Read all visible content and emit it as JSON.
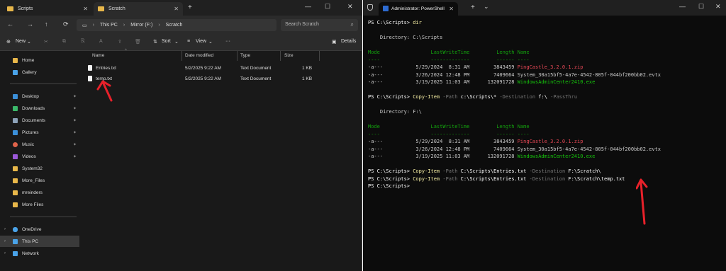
{
  "explorer": {
    "tabs": [
      {
        "label": "Scripts",
        "close": "✕"
      },
      {
        "label": "Scratch",
        "close": "✕"
      }
    ],
    "new_tab": "+",
    "window_controls": [
      "—",
      "☐",
      "✕"
    ],
    "nav_icons": [
      "←",
      "→",
      "↑",
      "⟳"
    ],
    "breadcrumb": {
      "monitor": "▭",
      "items": [
        "This PC",
        "Mirror (F:)",
        "Scratch"
      ],
      "sep": "›"
    },
    "search_placeholder": "Search Scratch",
    "search_icon": "⌕",
    "toolbar": {
      "new_label": "New",
      "new_plus": "⊕",
      "caret": "⌄",
      "dim_icons": [
        "✂",
        "⧉",
        "⎘",
        "A",
        "⇪",
        "🗑"
      ],
      "sort_label": "Sort",
      "view_label": "View",
      "more": "···",
      "details_label": "Details"
    },
    "nav_items": [
      {
        "label": "Home",
        "color": "#e8b74a"
      },
      {
        "label": "Gallery",
        "color": "#4aa3e8"
      },
      {
        "label": "Desktop",
        "color": "#3b8fd9"
      },
      {
        "label": "Downloads",
        "color": "#3bb86a"
      },
      {
        "label": "Documents",
        "color": "#8da2b8"
      },
      {
        "label": "Pictures",
        "color": "#3b8fd9"
      },
      {
        "label": "Music",
        "color": "#e0634a"
      },
      {
        "label": "Videos",
        "color": "#9b59d9"
      },
      {
        "label": "System32",
        "color": "#e8b74a"
      },
      {
        "label": "More_Files",
        "color": "#e8b74a"
      },
      {
        "label": "mreinders",
        "color": "#e8b74a"
      },
      {
        "label": "More Files",
        "color": "#e8b74a"
      },
      {
        "label": "OneDrive",
        "color": "#4aa3e8"
      },
      {
        "label": "This PC",
        "color": "#4aa3e8"
      },
      {
        "label": "Network",
        "color": "#4aa3e8"
      }
    ],
    "pin_glyph": "📌",
    "chevron": "›",
    "columns": [
      "Name",
      "Date modified",
      "Type",
      "Size"
    ],
    "sort_arrow": "^",
    "files": [
      {
        "name": "Entries.txt",
        "date": "5/2/2025 9:22 AM",
        "type": "Text Document",
        "size": "1 KB"
      },
      {
        "name": "temp.txt",
        "date": "5/2/2025 9:22 AM",
        "type": "Text Document",
        "size": "1 KB"
      }
    ]
  },
  "terminal": {
    "tab_title": "Administrator: PowerShell",
    "tab_close": "✕",
    "new_tab": "+",
    "dropdown": "⌄",
    "window_controls": [
      "—",
      "☐",
      "✕"
    ],
    "lines": [
      {
        "spans": [
          {
            "t": "PS C:\\Scripts> ",
            "c": "w"
          },
          {
            "t": "dir",
            "c": "y"
          }
        ]
      },
      {
        "spans": [
          {
            "t": "",
            "c": ""
          }
        ]
      },
      {
        "spans": [
          {
            "t": "    Directory: C:\\Scripts",
            "c": ""
          }
        ]
      },
      {
        "spans": [
          {
            "t": "",
            "c": ""
          }
        ]
      },
      {
        "spans": [
          {
            "t": "Mode                 LastWriteTime         Length Name",
            "c": "g"
          }
        ]
      },
      {
        "spans": [
          {
            "t": "----                 -------------         ------ ----",
            "c": "g"
          }
        ]
      },
      {
        "spans": [
          {
            "t": "-a---           5/29/2024  8:31 AM        3843459 ",
            "c": ""
          },
          {
            "t": "PingCastle_3.2.0.1.zip",
            "c": "r"
          }
        ]
      },
      {
        "spans": [
          {
            "t": "-a---           3/26/2024 12:48 PM        7409664 System_30a15bf5-4a7e-4542-805f-044bf200bb02.evtx",
            "c": ""
          }
        ]
      },
      {
        "spans": [
          {
            "t": "-a---           3/19/2025 11:03 AM      132091728 ",
            "c": ""
          },
          {
            "t": "WindowsAdminCenter2410.exe",
            "c": "hl-g"
          }
        ]
      },
      {
        "spans": [
          {
            "t": "",
            "c": ""
          }
        ]
      },
      {
        "spans": [
          {
            "t": "PS C:\\Scripts> ",
            "c": "w"
          },
          {
            "t": "Copy-Item",
            "c": "y"
          },
          {
            "t": " -Path ",
            "c": "k"
          },
          {
            "t": "c:\\Scripts\\*",
            "c": "w"
          },
          {
            "t": " -Destination ",
            "c": "k"
          },
          {
            "t": "f:\\",
            "c": "w"
          },
          {
            "t": " -PassThru",
            "c": "k"
          }
        ]
      },
      {
        "spans": [
          {
            "t": "",
            "c": ""
          }
        ]
      },
      {
        "spans": [
          {
            "t": "    Directory: F:\\",
            "c": ""
          }
        ]
      },
      {
        "spans": [
          {
            "t": "",
            "c": ""
          }
        ]
      },
      {
        "spans": [
          {
            "t": "Mode                 LastWriteTime         Length Name",
            "c": "g"
          }
        ]
      },
      {
        "spans": [
          {
            "t": "----                 -------------         ------ ----",
            "c": "g"
          }
        ]
      },
      {
        "spans": [
          {
            "t": "-a---           5/29/2024  8:31 AM        3843459 ",
            "c": ""
          },
          {
            "t": "PingCastle_3.2.0.1.zip",
            "c": "r"
          }
        ]
      },
      {
        "spans": [
          {
            "t": "-a---           3/26/2024 12:48 PM        7409664 System_30a15bf5-4a7e-4542-805f-044bf200bb02.evtx",
            "c": ""
          }
        ]
      },
      {
        "spans": [
          {
            "t": "-a---           3/19/2025 11:03 AM      132091728 ",
            "c": ""
          },
          {
            "t": "WindowsAdminCenter2410.exe",
            "c": "hl-g"
          }
        ]
      },
      {
        "spans": [
          {
            "t": "",
            "c": ""
          }
        ]
      },
      {
        "spans": [
          {
            "t": "PS C:\\Scripts> ",
            "c": "w"
          },
          {
            "t": "Copy-Item",
            "c": "y"
          },
          {
            "t": " -Path ",
            "c": "k"
          },
          {
            "t": "C:\\Scripts\\Entries.txt",
            "c": "w"
          },
          {
            "t": " -Destination ",
            "c": "k"
          },
          {
            "t": "F:\\Scratch\\",
            "c": "w"
          }
        ]
      },
      {
        "spans": [
          {
            "t": "PS C:\\Scripts> ",
            "c": "w"
          },
          {
            "t": "Copy-Item",
            "c": "y"
          },
          {
            "t": " -Path ",
            "c": "k"
          },
          {
            "t": "C:\\Scripts\\Entries.txt",
            "c": "w"
          },
          {
            "t": " -Destination ",
            "c": "k"
          },
          {
            "t": "F:\\Scratch\\temp.txt",
            "c": "w"
          }
        ]
      },
      {
        "spans": [
          {
            "t": "PS C:\\Scripts> ",
            "c": "w"
          }
        ]
      }
    ]
  },
  "colors": {
    "annotation_arrow": "#e8212a"
  }
}
